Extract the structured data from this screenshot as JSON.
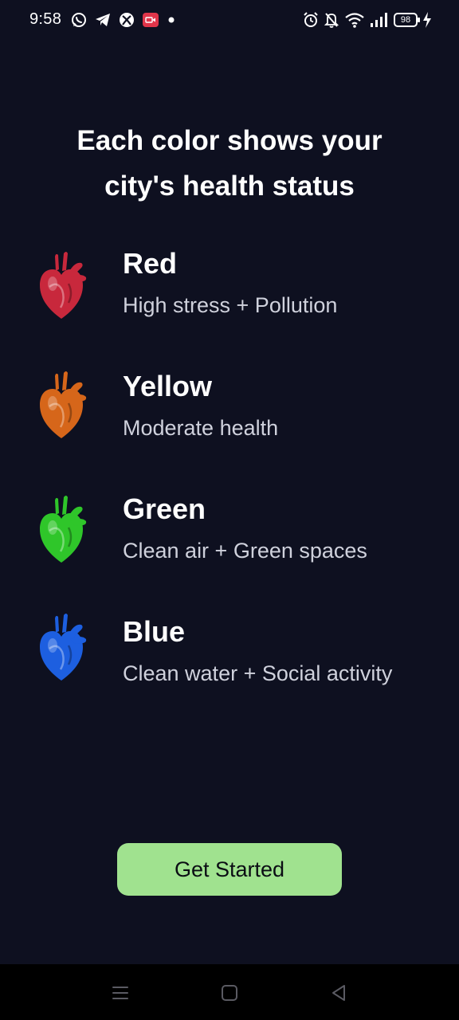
{
  "status_bar": {
    "time": "9:58",
    "battery": "98",
    "left_icons": [
      "whatsapp-icon",
      "telegram-icon",
      "xbox-icon",
      "screen-record-icon",
      "notification-dot-icon"
    ],
    "right_icons": [
      "alarm-icon",
      "mute-icon",
      "wifi-icon",
      "signal-icon",
      "battery-icon",
      "charging-icon"
    ]
  },
  "title": {
    "line1": "Each color shows your",
    "line2": "city's health status"
  },
  "items": [
    {
      "name": "Red",
      "description": "High stress + Pollution",
      "color": "#c8283c",
      "icon": "red-heart-icon"
    },
    {
      "name": "Yellow",
      "description": "Moderate health",
      "color": "#d6661a",
      "icon": "orange-heart-icon"
    },
    {
      "name": "Green",
      "description": "Clean air + Green spaces",
      "color": "#2fc62a",
      "icon": "green-heart-icon"
    },
    {
      "name": "Blue",
      "description": "Clean water + Social activity",
      "color": "#1d5fe0",
      "icon": "blue-heart-icon"
    }
  ],
  "cta": {
    "label": "Get Started",
    "background": "#a0e28f"
  },
  "nav": {
    "icons": [
      "recent-apps-icon",
      "home-icon",
      "back-icon"
    ]
  },
  "theme": {
    "background": "#0e1020"
  }
}
